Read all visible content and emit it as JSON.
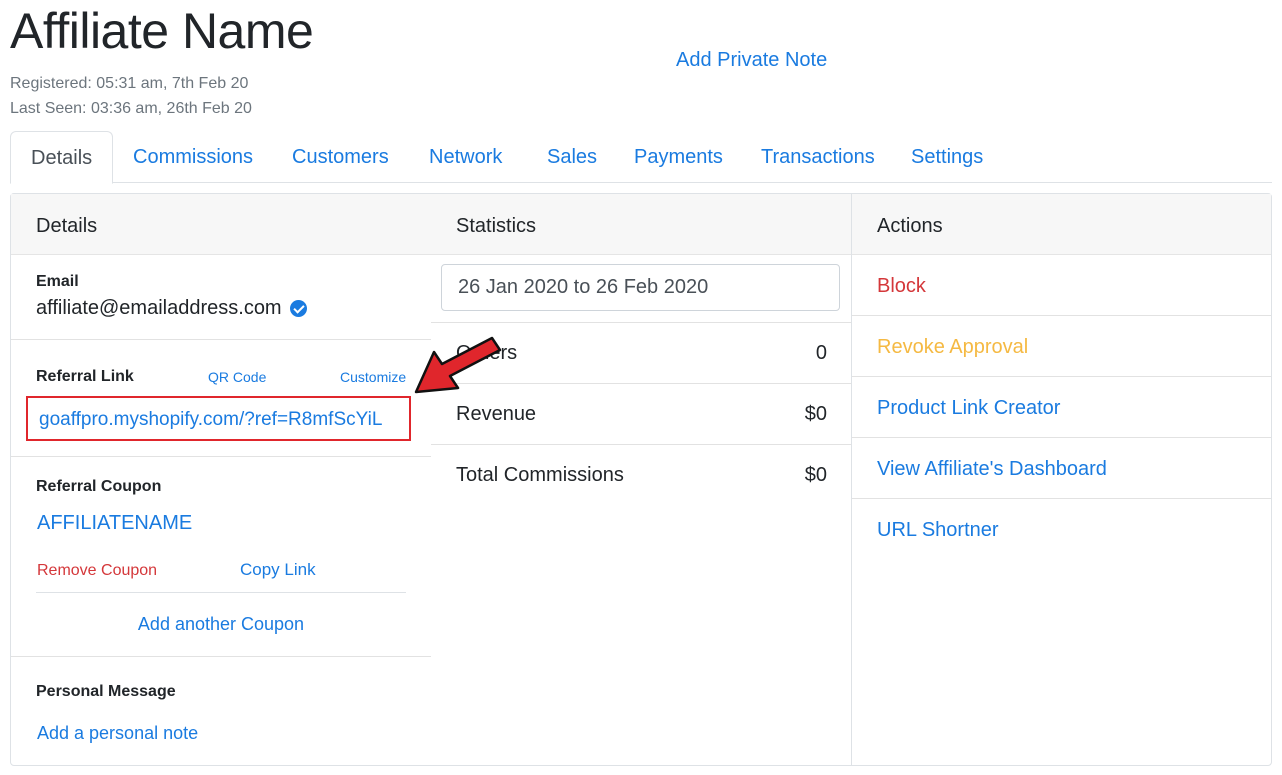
{
  "header": {
    "title": "Affiliate Name",
    "registered": "Registered: 05:31 am, 7th Feb 20",
    "last_seen": "Last Seen: 03:36 am, 26th Feb 20",
    "private_note_link": "Add Private Note"
  },
  "tabs": [
    {
      "label": "Details",
      "active": true
    },
    {
      "label": "Commissions"
    },
    {
      "label": "Customers"
    },
    {
      "label": "Network"
    },
    {
      "label": "Sales"
    },
    {
      "label": "Payments"
    },
    {
      "label": "Transactions"
    },
    {
      "label": "Settings"
    }
  ],
  "details": {
    "heading": "Details",
    "email_label": "Email",
    "email_value": "affiliate@emailaddress.com",
    "referral_label": "Referral Link",
    "qr_code_link": "QR Code",
    "customize_link": "Customize",
    "referral_url": "goaffpro.myshopify.com/?ref=R8mfScYiL",
    "coupon_label": "Referral Coupon",
    "coupon_code": "AFFILIATENAME",
    "remove_coupon": "Remove Coupon",
    "copy_link": "Copy Link",
    "add_coupon": "Add another Coupon",
    "message_label": "Personal Message",
    "add_note": "Add a personal note"
  },
  "statistics": {
    "heading": "Statistics",
    "date_range": "26 Jan 2020 to 26 Feb 2020",
    "rows": [
      {
        "label": "Orders",
        "value": "0"
      },
      {
        "label": "Revenue",
        "value": "$0"
      },
      {
        "label": "Total Commissions",
        "value": "$0"
      }
    ]
  },
  "actions": {
    "heading": "Actions",
    "items": [
      {
        "label": "Block",
        "color": "#d4373a"
      },
      {
        "label": "Revoke Approval",
        "color": "#f5b942"
      },
      {
        "label": "Product Link Creator",
        "color": "#1a7be0"
      },
      {
        "label": "View Affiliate's Dashboard",
        "color": "#1a7be0"
      },
      {
        "label": "URL Shortner",
        "color": "#1a7be0"
      }
    ]
  },
  "colors": {
    "link": "#1a7be0",
    "danger": "#d4373a",
    "warning": "#f5b942",
    "annotation": "#e0262c"
  }
}
